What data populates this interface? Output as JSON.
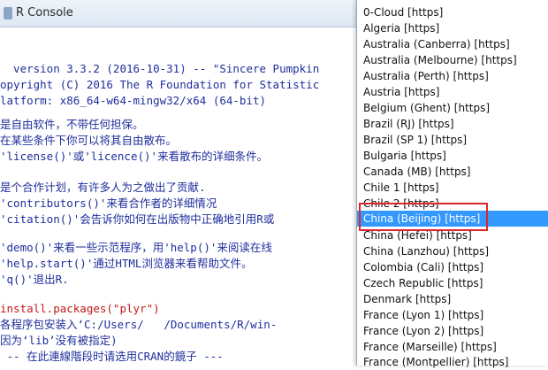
{
  "window": {
    "title": "R Console"
  },
  "console": {
    "lines": [
      "  version 3.3.2 (2016-10-31) -- \"Sincere Pumpkin",
      "opyright (C) 2016 The R Foundation for Statistic",
      "latform: x86_64-w64-mingw32/x64 (64-bit)",
      "",
      "是自由软件，不带任何担保。",
      "在某些条件下你可以将其自由散布。",
      "'license()'或'licence()'来看散布的详细条件。",
      "",
      "是个合作计划，有许多人为之做出了贡献.",
      "'contributors()'来看合作者的详细情况",
      "'citation()'会告诉你如何在出版物中正确地引用R或",
      "",
      "'demo()'来看一些示范程序，用'help()'来阅读在线",
      "'help.start()'通过HTML浏览器来看帮助文件。",
      "'q()'退出R.",
      "",
      "install.packages(\"plyr\")",
      "各程序包安装入‘C:/Users/   /Documents/R/win-",
      "因为‘lib’没有被指定)",
      " -- 在此連線階段时请选用CRAN的鏡子 ---"
    ],
    "red_lines": [
      16
    ]
  },
  "mirrors": {
    "items": [
      "0-Cloud [https]",
      "Algeria [https]",
      "Australia (Canberra) [https]",
      "Australia (Melbourne) [https]",
      "Australia (Perth) [https]",
      "Austria [https]",
      "Belgium (Ghent) [https]",
      "Brazil (RJ) [https]",
      "Brazil (SP 1) [https]",
      "Bulgaria [https]",
      "Canada (MB) [https]",
      "Chile 1 [https]",
      "Chile 2 [https]",
      "China (Beijing) [https]",
      "China (Hefei) [https]",
      "China (Lanzhou) [https]",
      "Colombia (Cali) [https]",
      "Czech Republic [https]",
      "Denmark [https]",
      "France (Lyon 1) [https]",
      "France (Lyon 2) [https]",
      "France (Marseille) [https]",
      "France (Montpellier) [https]"
    ],
    "selected_index": 13
  }
}
